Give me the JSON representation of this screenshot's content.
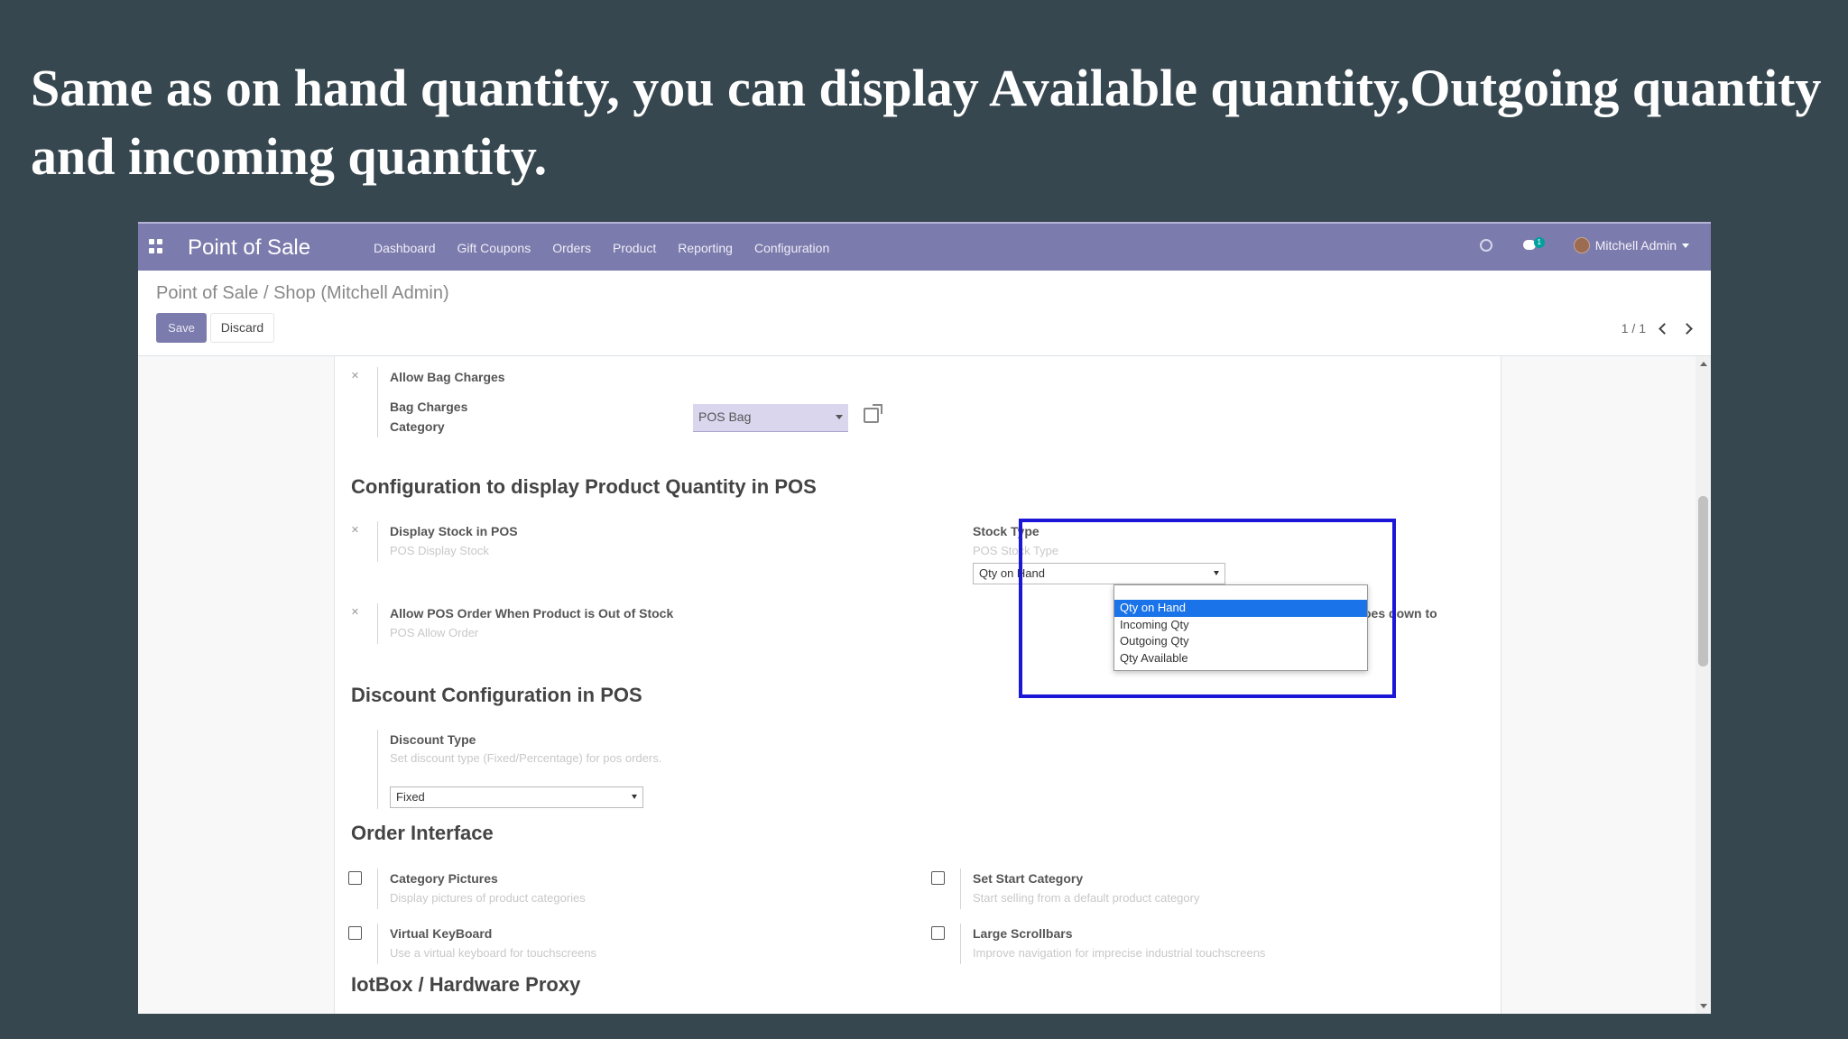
{
  "slide": {
    "heading": "Same as on hand quantity, you can display Available quantity,Outgoing quantity and incoming quantity."
  },
  "navbar": {
    "app_name": "Point of Sale",
    "menu": [
      "Dashboard",
      "Gift Coupons",
      "Orders",
      "Product",
      "Reporting",
      "Configuration"
    ],
    "chat_count": "1",
    "user_name": "Mitchell Admin"
  },
  "control_panel": {
    "breadcrumb": "Point of Sale / Shop (Mitchell Admin)",
    "save_label": "Save",
    "discard_label": "Discard",
    "pager": "1 / 1"
  },
  "form": {
    "bag": {
      "allow_label": "Allow Bag Charges",
      "category_label_line1": "Bag Charges",
      "category_label_line2": "Category",
      "category_value": "POS Bag"
    },
    "product_qty_section": {
      "title": "Configuration to display Product Quantity in POS",
      "display_stock_label": "Display Stock in POS",
      "display_stock_hint": "POS Display Stock",
      "allow_order_label": "Allow POS Order When Product is Out of Stock",
      "allow_order_hint": "POS Allow Order",
      "partial_text": "oes down to",
      "stock_type_label": "Stock Type",
      "stock_type_hint": "POS Stock Type",
      "stock_type_value": "Qty on Hand",
      "stock_type_options": [
        "Qty on Hand",
        "Incoming Qty",
        "Outgoing Qty",
        "Qty Available"
      ]
    },
    "discount_section": {
      "title": "Discount Configuration in POS",
      "type_label": "Discount Type",
      "type_hint": "Set discount type (Fixed/Percentage) for pos orders.",
      "type_value": "Fixed"
    },
    "order_interface": {
      "title": "Order Interface",
      "category_pictures_label": "Category Pictures",
      "category_pictures_hint": "Display pictures of product categories",
      "virtual_keyboard_label": "Virtual KeyBoard",
      "virtual_keyboard_hint": "Use a virtual keyboard for touchscreens",
      "start_category_label": "Set Start Category",
      "start_category_hint": "Start selling from a default product category",
      "large_scrollbars_label": "Large Scrollbars",
      "large_scrollbars_hint": "Improve navigation for imprecise industrial touchscreens"
    },
    "iotbox_section": {
      "title": "IotBox / Hardware Proxy"
    }
  },
  "colors": {
    "slide_background": "#37474f",
    "navbar": "#7c7bad",
    "highlight_border": "#1c16d6",
    "selected_option": "#1a73e8"
  }
}
